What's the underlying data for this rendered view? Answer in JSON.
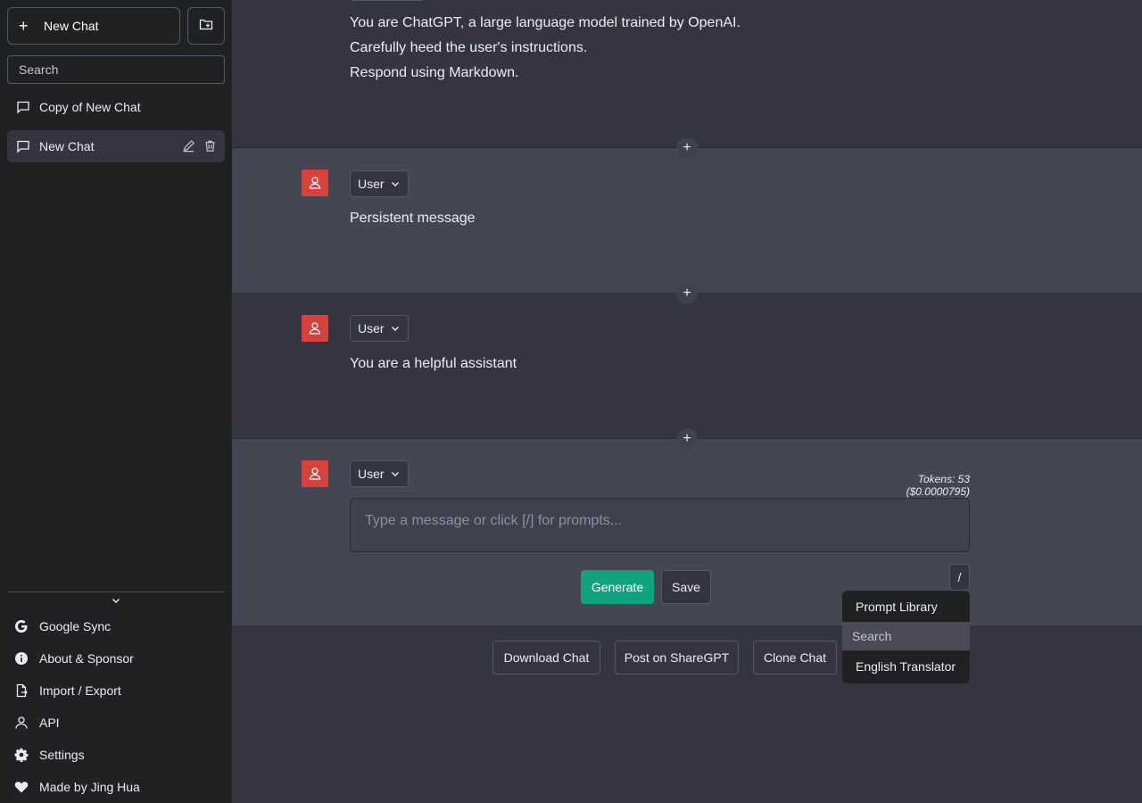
{
  "sidebar": {
    "new_chat_label": "New Chat",
    "search_placeholder": "Search",
    "chats": [
      {
        "label": "Copy of New Chat"
      },
      {
        "label": "New Chat"
      }
    ],
    "menu": [
      {
        "label": "Google Sync",
        "icon": "google-icon"
      },
      {
        "label": "About & Sponsor",
        "icon": "info-icon"
      },
      {
        "label": "Import / Export",
        "icon": "file-export-icon"
      },
      {
        "label": "API",
        "icon": "person-icon"
      },
      {
        "label": "Settings",
        "icon": "gear-icon"
      },
      {
        "label": "Made by Jing Hua",
        "icon": "heart-icon"
      }
    ]
  },
  "messages": [
    {
      "role": "",
      "lines": [
        "You are ChatGPT, a large language model trained by OpenAI.",
        "Carefully heed the user's instructions.",
        "Respond using Markdown."
      ]
    },
    {
      "role": "User",
      "text": "Persistent message"
    },
    {
      "role": "User",
      "text": "You are a helpful assistant"
    },
    {
      "role": "User"
    }
  ],
  "composer": {
    "tokens": "Tokens: 53 ($0.0000795)",
    "placeholder": "Type a message or click [/] for prompts...",
    "generate_label": "Generate",
    "save_label": "Save",
    "slash_label": "/"
  },
  "prompt_library": {
    "title": "Prompt Library",
    "search_placeholder": "Search",
    "items": [
      "English Translator"
    ]
  },
  "bottom_actions": {
    "download": "Download Chat",
    "share": "Post on ShareGPT",
    "clone": "Clone Chat"
  },
  "colors": {
    "sidebar_bg": "#202123",
    "main_bg": "#343541",
    "alt_bg": "#444654",
    "avatar": "#d9413d",
    "accent": "#10a37f"
  }
}
